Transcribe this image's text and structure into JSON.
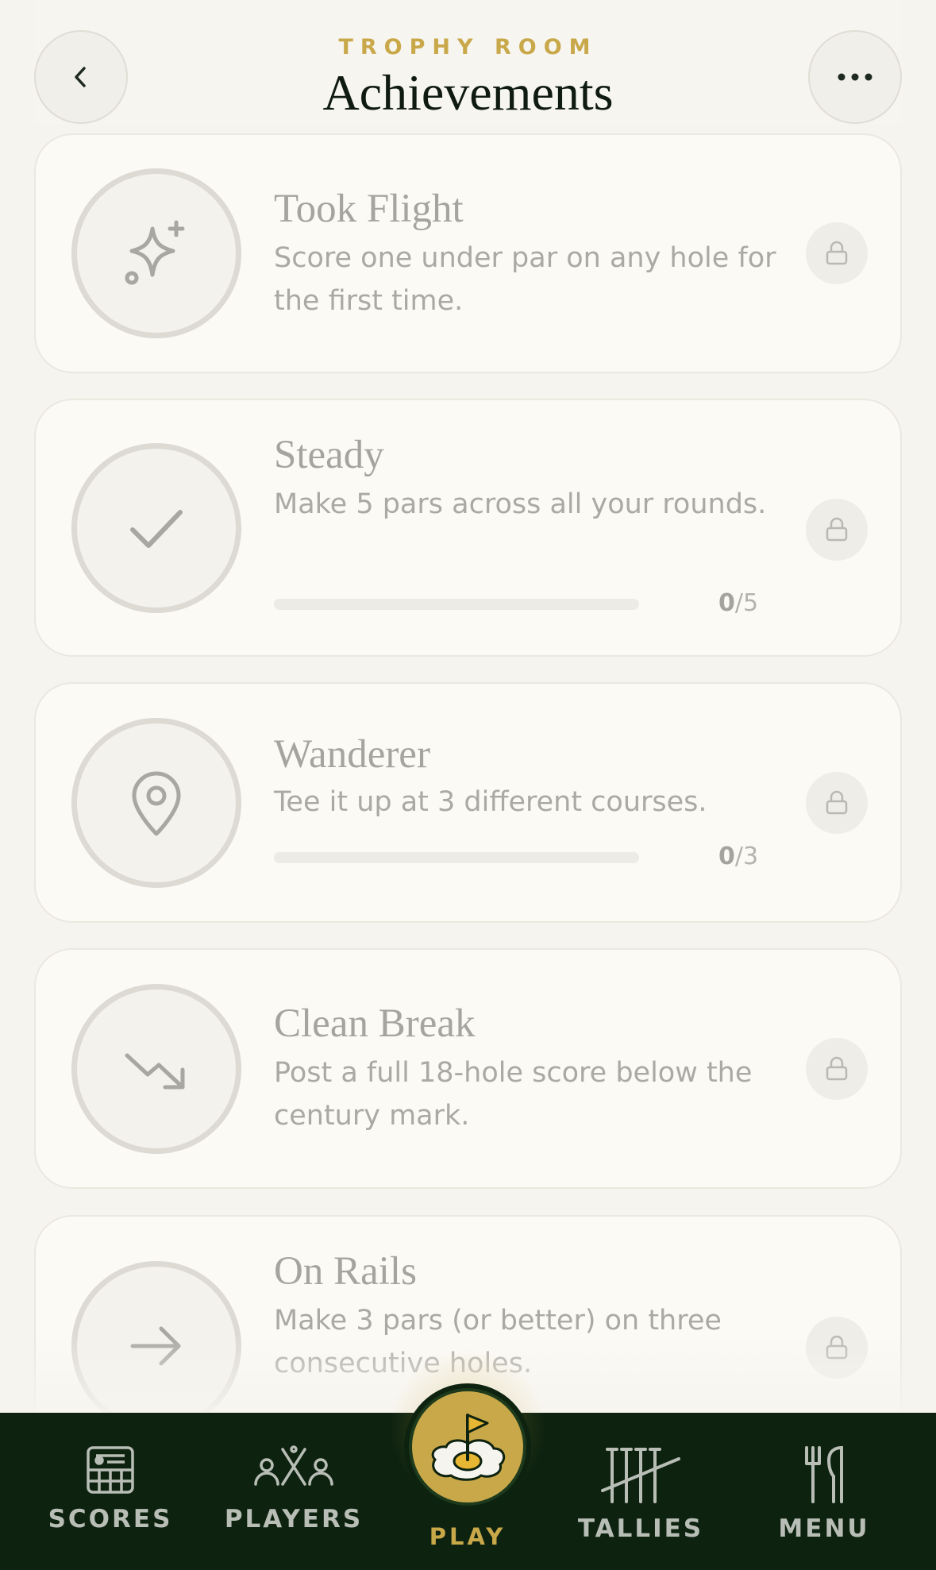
{
  "header": {
    "eyebrow": "TROPHY ROOM",
    "title": "Achievements"
  },
  "achievements": [
    {
      "title": "Took Flight",
      "description": "Score one under par on any hole for the first time.",
      "icon": "sparkle-icon",
      "locked": true
    },
    {
      "title": "Steady",
      "description": "Make 5 pars across all your rounds.",
      "icon": "check-icon",
      "locked": true,
      "progress": {
        "current": "0",
        "total": "/5",
        "fraction": 0
      }
    },
    {
      "title": "Wanderer",
      "description": "Tee it up at 3 different courses.",
      "icon": "map-pin-icon",
      "locked": true,
      "progress": {
        "current": "0",
        "total": "/3",
        "fraction": 0
      }
    },
    {
      "title": "Clean Break",
      "description": "Post a full 18-hole score below the century mark.",
      "icon": "trend-down-icon",
      "locked": true
    },
    {
      "title": "On Rails",
      "description": "Make 3 pars (or better) on three consecutive holes.",
      "icon": "arrow-right-icon",
      "locked": true
    }
  ],
  "nav": {
    "scores": "SCORES",
    "players": "PLAYERS",
    "play": "PLAY",
    "tallies": "TALLIES",
    "menu": "MENU"
  },
  "colors": {
    "accent": "#c9a84a",
    "nav_background": "#0d220f",
    "page_background": "#f6f4ee"
  }
}
